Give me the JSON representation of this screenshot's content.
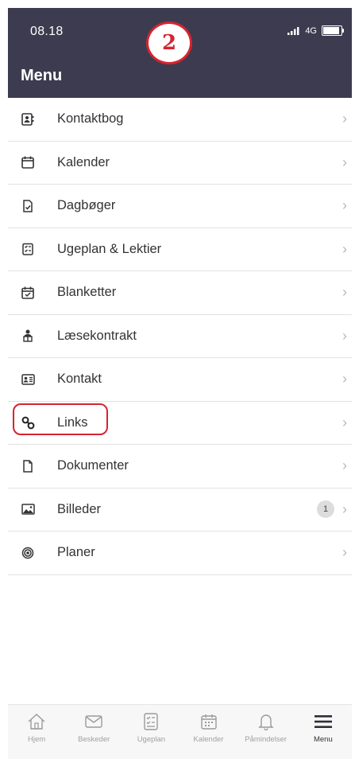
{
  "status_bar": {
    "time": "08.18",
    "network": "4G"
  },
  "annotation_number": "2",
  "header": {
    "title": "Menu"
  },
  "menu": [
    {
      "label": "Kontaktbog",
      "icon": "contact-book-icon"
    },
    {
      "label": "Kalender",
      "icon": "calendar-icon"
    },
    {
      "label": "Dagbøger",
      "icon": "diary-icon"
    },
    {
      "label": "Ugeplan & Lektier",
      "icon": "weekplan-icon"
    },
    {
      "label": "Blanketter",
      "icon": "forms-icon"
    },
    {
      "label": "Læsekontrakt",
      "icon": "reading-contract-icon"
    },
    {
      "label": "Kontakt",
      "icon": "contact-card-icon"
    },
    {
      "label": "Links",
      "icon": "link-icon"
    },
    {
      "label": "Dokumenter",
      "icon": "document-icon"
    },
    {
      "label": "Billeder",
      "icon": "image-icon",
      "badge": "1"
    },
    {
      "label": "Planer",
      "icon": "target-icon"
    }
  ],
  "tabbar": [
    {
      "label": "Hjem",
      "icon": "home-icon"
    },
    {
      "label": "Beskeder",
      "icon": "mail-icon"
    },
    {
      "label": "Ugeplan",
      "icon": "weekplan-icon"
    },
    {
      "label": "Kalender",
      "icon": "calendar-icon"
    },
    {
      "label": "Påmindelser",
      "icon": "bell-icon"
    },
    {
      "label": "Menu",
      "icon": "menu-icon",
      "active": true
    }
  ],
  "colors": {
    "header_bg": "#3d3b4f",
    "annotation_red": "#d62430"
  }
}
